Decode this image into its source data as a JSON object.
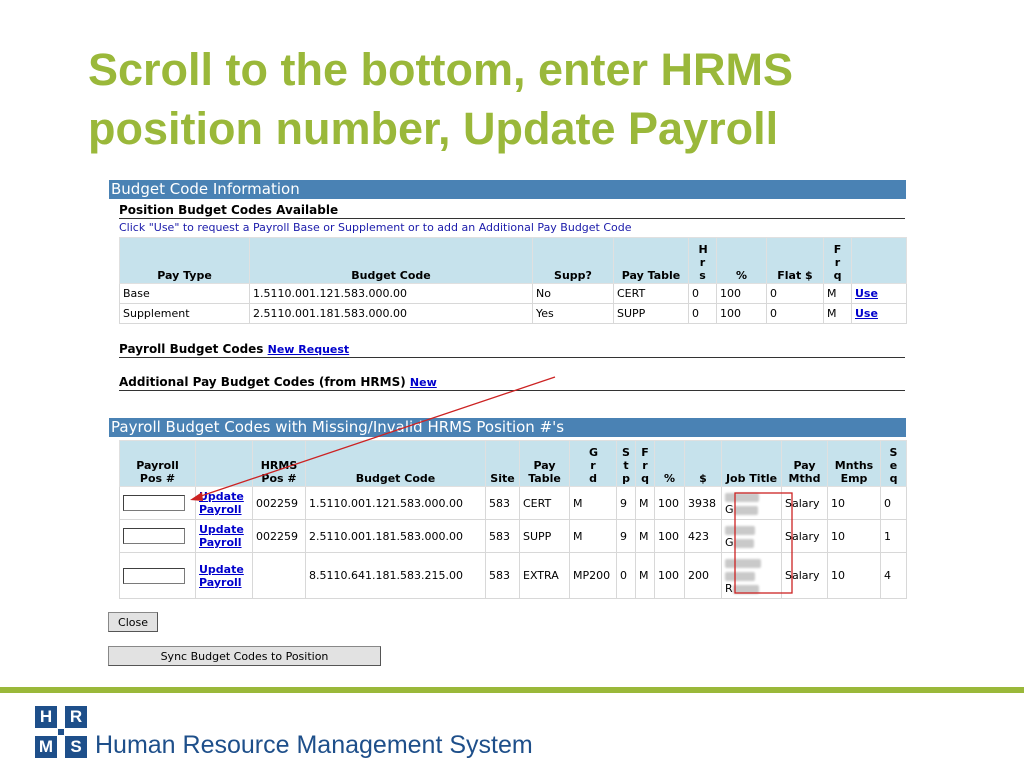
{
  "slide": {
    "title_line1": "Scroll to the bottom, enter HRMS",
    "title_line2": "position number, Update Payroll",
    "accent_color": "#9ab83a"
  },
  "budget_info": {
    "heading": "Budget Code Information",
    "available_heading": "Position Budget Codes Available",
    "instruction": "Click \"Use\" to request a Payroll Base or Supplement or to add an Additional Pay Budget Code",
    "columns": {
      "pay_type": "Pay Type",
      "budget_code": "Budget Code",
      "supp": "Supp?",
      "pay_table": "Pay Table",
      "hrs": [
        "H",
        "r",
        "s"
      ],
      "pct": "%",
      "flat": "Flat $",
      "frq": [
        "F",
        "r",
        "q"
      ]
    },
    "rows": [
      {
        "pay_type": "Base",
        "budget_code": "1.5110.001.121.583.000.00",
        "supp": "No",
        "pay_table": "CERT",
        "hrs": "0",
        "pct": "100",
        "flat": "0",
        "frq": "M",
        "action": "Use"
      },
      {
        "pay_type": "Supplement",
        "budget_code": "2.5110.001.181.583.000.00",
        "supp": "Yes",
        "pay_table": "SUPP",
        "hrs": "0",
        "pct": "100",
        "flat": "0",
        "frq": "M",
        "action": "Use"
      }
    ],
    "payroll_heading": "Payroll Budget Codes",
    "payroll_link": "New Request",
    "additional_heading": "Additional Pay Budget Codes (from HRMS)",
    "additional_link": "New"
  },
  "missing": {
    "heading": "Payroll Budget Codes with Missing/Invalid HRMS Position #'s",
    "columns": {
      "payroll_pos_1": "Payroll",
      "payroll_pos_2": "Pos #",
      "hrms_pos_1": "HRMS",
      "hrms_pos_2": "Pos #",
      "budget_code": "Budget Code",
      "site": "Site",
      "pay_table_1": "Pay",
      "pay_table_2": "Table",
      "grd": [
        "G",
        "r",
        "d"
      ],
      "stp": [
        "S",
        "t",
        "p"
      ],
      "frq": [
        "F",
        "r",
        "q"
      ],
      "pct": "%",
      "amount": "$",
      "job_title": "Job Title",
      "pay_mthd_1": "Pay",
      "pay_mthd_2": "Mthd",
      "mnths_emp_1": "Mnths",
      "mnths_emp_2": "Emp",
      "seq": [
        "S",
        "e",
        "q"
      ]
    },
    "rows": [
      {
        "payroll_pos": "",
        "link1": "Update",
        "link2": "Payroll",
        "hrms_pos": "002259",
        "budget_code": "1.5110.001.121.583.000.00",
        "site": "583",
        "pay_table": "CERT",
        "grd": "M",
        "stp": "9",
        "frq": "M",
        "pct": "100",
        "amount": "3938",
        "job_title_prefix": "G",
        "pay_mthd": "Salary",
        "mnths": "10",
        "seq": "0"
      },
      {
        "payroll_pos": "",
        "link1": "Update",
        "link2": "Payroll",
        "hrms_pos": "002259",
        "budget_code": "2.5110.001.181.583.000.00",
        "site": "583",
        "pay_table": "SUPP",
        "grd": "M",
        "stp": "9",
        "frq": "M",
        "pct": "100",
        "amount": "423",
        "job_title_prefix": "G",
        "pay_mthd": "Salary",
        "mnths": "10",
        "seq": "1"
      },
      {
        "payroll_pos": "",
        "link1": "Update",
        "link2": "Payroll",
        "hrms_pos": "",
        "budget_code": "8.5110.641.181.583.215.00",
        "site": "583",
        "pay_table": "EXTRA",
        "grd": "MP200",
        "stp": "0",
        "frq": "M",
        "pct": "100",
        "amount": "200",
        "job_title_prefix": "R",
        "pay_mthd": "Salary",
        "mnths": "10",
        "seq": "4"
      }
    ]
  },
  "buttons": {
    "close": "Close",
    "sync": "Sync Budget Codes to Position"
  },
  "footer": {
    "logo_letters": [
      "H",
      "R",
      "M",
      "S"
    ],
    "brand": "Human Resource Management System",
    "brand_color": "#1e4f8a"
  },
  "annotation_color": "#cc2222"
}
